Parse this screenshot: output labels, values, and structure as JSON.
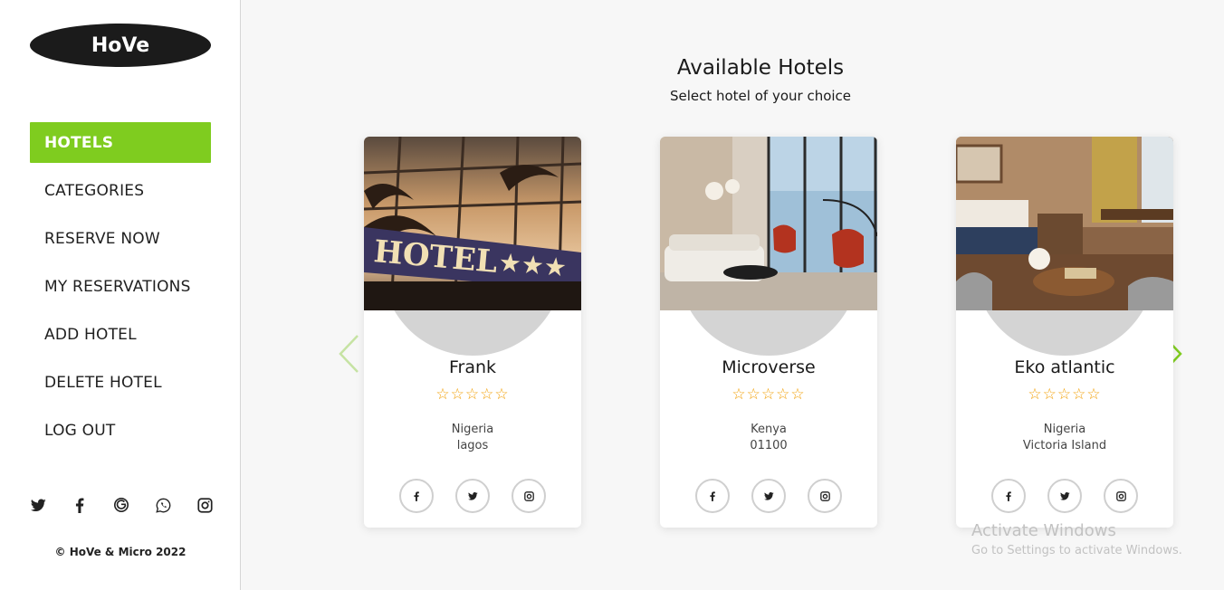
{
  "app": {
    "logo_text": "HoVe",
    "accent_color": "#7fcc1f",
    "star_color": "#f2a007"
  },
  "sidebar": {
    "items": [
      {
        "label": "HOTELS",
        "active": true
      },
      {
        "label": "CATEGORIES"
      },
      {
        "label": "RESERVE NOW"
      },
      {
        "label": "MY RESERVATIONS"
      },
      {
        "label": "ADD HOTEL"
      },
      {
        "label": "DELETE HOTEL"
      },
      {
        "label": "LOG OUT"
      }
    ],
    "social_icons": [
      "twitter-icon",
      "facebook-icon",
      "google-icon",
      "whatsapp-icon",
      "instagram-icon"
    ],
    "copyright": "© HoVe & Micro 2022"
  },
  "main": {
    "title": "Available Hotels",
    "subtitle": "Select hotel of your choice",
    "hotels": [
      {
        "name": "Frank",
        "stars": "☆☆☆☆☆",
        "country": "Nigeria",
        "city": "lagos",
        "photo_text": "HOTEL"
      },
      {
        "name": "Microverse",
        "stars": "☆☆☆☆☆",
        "country": "Kenya",
        "city": "01100"
      },
      {
        "name": "Eko atlantic",
        "stars": "☆☆☆☆☆",
        "country": "Nigeria",
        "city": "Victoria Island"
      }
    ],
    "card_social_icons": [
      "facebook-icon",
      "twitter-icon",
      "instagram-icon"
    ]
  },
  "watermark": {
    "title": "Activate Windows",
    "subtitle": "Go to Settings to activate Windows."
  }
}
